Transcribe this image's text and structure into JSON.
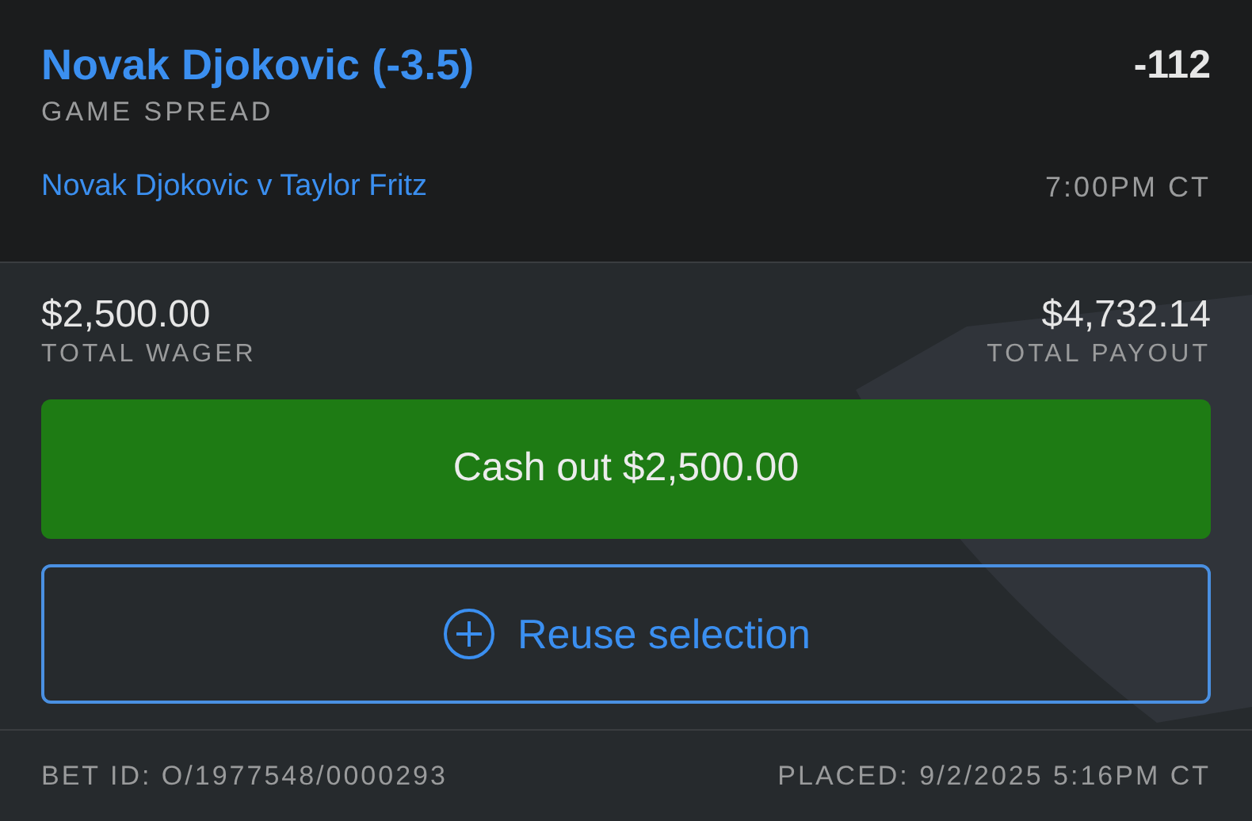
{
  "selection": {
    "title": "Novak Djokovic (-3.5)",
    "odds": "-112",
    "market": "GAME SPREAD",
    "event": "Novak Djokovic v Taylor Fritz",
    "start_time": "7:00PM CT"
  },
  "totals": [
    {
      "amount": "$2,500.00",
      "label": "TOTAL WAGER"
    },
    {
      "amount": "$4,732.14",
      "label": "TOTAL PAYOUT"
    }
  ],
  "cash_out_button": "Cash out $2,500.00",
  "reuse_button": "Reuse selection",
  "footer": {
    "bet_id": "BET ID: O/1977548/0000293",
    "placed": "PLACED: 9/2/2025 5:16PM CT"
  }
}
